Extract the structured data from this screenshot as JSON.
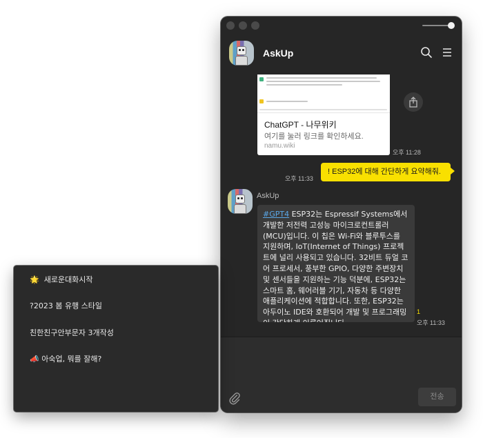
{
  "window": {
    "header_title": "AskUp",
    "icons": {
      "search": "search-icon",
      "menu": "hamburger-menu-icon",
      "share": "share-icon",
      "attach": "paperclip-icon"
    }
  },
  "chat": {
    "link_card": {
      "title": "ChatGPT - 나무위키",
      "description": "여기를 눌러 링크를 확인하세요.",
      "domain": "namu.wiki",
      "time": "오후 11:28"
    },
    "user_message": {
      "text": "! ESP32에 대해 간단하게 요약해줘.",
      "time": "오후 11:33"
    },
    "bot_message": {
      "sender": "AskUp",
      "hashtag": "#GPT4",
      "text": " ESP32는 Espressif Systems에서 개발한 저전력 고성능 마이크로컨트롤러(MCU)입니다. 이 칩은 Wi-Fi와 블루투스를 지원하며, IoT(Internet of Things) 프로젝트에 널리 사용되고 있습니다. 32비트 듀얼 코어 프로세서, 풍부한 GPIO, 다양한 주변장치 및 센서들을 지원하는 기능 덕분에, ESP32는 스마트 홈, 웨어러블 기기, 자동차 등 다양한 애플리케이션에 적합합니다. 또한, ESP32는 아두이노 IDE와 호환되어 개발 및 프로그래밍이 간단하게 이루어집니다.",
      "unread": "1",
      "time": "오후 11:33"
    }
  },
  "input": {
    "send_label": "전송"
  },
  "menu": {
    "items": [
      {
        "icon": "🌟",
        "label": "새로운대화시작"
      },
      {
        "icon": "",
        "label": "?2023 봄 유행 스타일"
      },
      {
        "icon": "",
        "label": "친한친구안부문자 3개작성"
      },
      {
        "icon": "📣",
        "label": "아숙업, 뭐를 잘해?"
      }
    ]
  },
  "colors": {
    "window_bg": "#262626",
    "user_bubble": "#f9e000",
    "bot_bubble": "#3a3a3a",
    "hashtag": "#5aa8e8"
  }
}
